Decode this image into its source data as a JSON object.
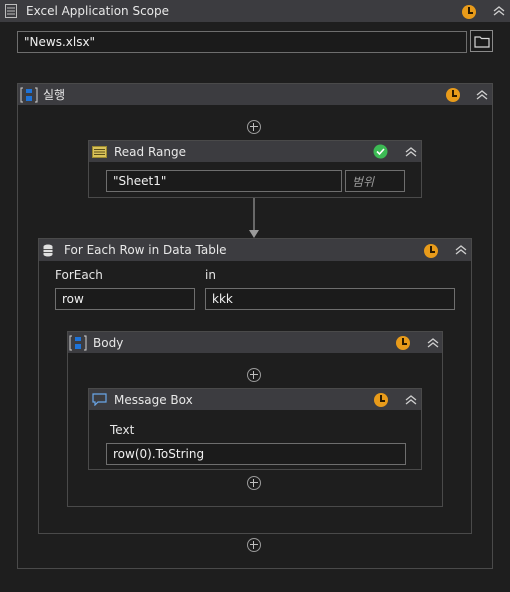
{
  "scope": {
    "title": "Excel Application Scope",
    "file_path": "\"News.xlsx\"",
    "icon": "excel-scope-icon"
  },
  "sequence": {
    "title": "실행",
    "icon": "sequence-icon"
  },
  "read_range": {
    "title": "Read Range",
    "sheet": "\"Sheet1\"",
    "range_placeholder": "범위",
    "status": "validated-check-icon"
  },
  "for_each": {
    "title": "For Each Row in Data Table",
    "foreach_label": "ForEach",
    "foreach_value": "row",
    "in_label": "in",
    "in_value": "kkk"
  },
  "body": {
    "title": "Body"
  },
  "message_box": {
    "title": "Message Box",
    "text_label": "Text",
    "text_value": "row(0).ToString"
  },
  "colors": {
    "background": "#1e1e1e",
    "header": "#3c3c40",
    "accent_orange": "#e89b1a",
    "accent_green": "#3cba54",
    "accent_blue": "#1e73d8"
  }
}
